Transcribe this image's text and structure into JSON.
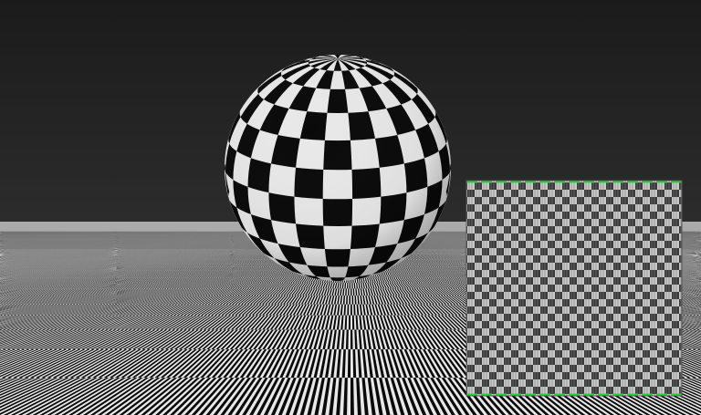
{
  "scene": {
    "background_color_top": "#1c1c1c",
    "background_color_bottom": "#3a3a3a",
    "checker_dark": "#0a0a0a",
    "checker_light": "#e8e8e8",
    "inset_border_color": "#2ecc40",
    "objects": [
      "checkered-sphere",
      "checkered-ground-plane",
      "texture-inset"
    ]
  }
}
